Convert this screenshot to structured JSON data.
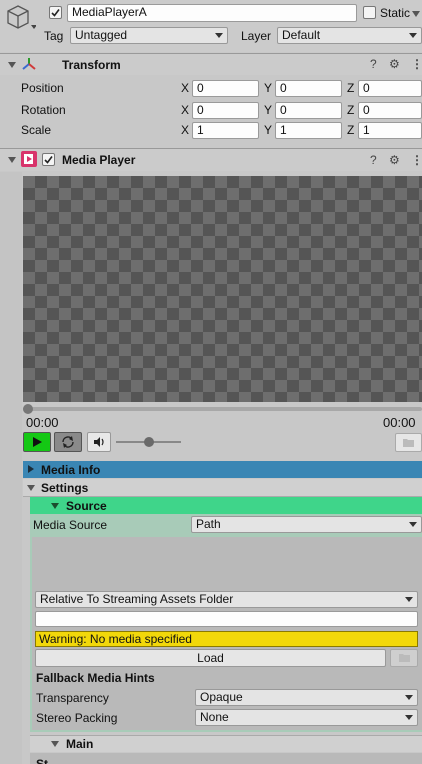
{
  "object": {
    "name": "MediaPlayerA",
    "static_label": "Static",
    "tag_label": "Tag",
    "tag_value": "Untagged",
    "layer_label": "Layer",
    "layer_value": "Default"
  },
  "transform": {
    "title": "Transform",
    "rows": [
      {
        "label": "Position",
        "x": "0",
        "y": "0",
        "z": "0"
      },
      {
        "label": "Rotation",
        "x": "0",
        "y": "0",
        "z": "0"
      },
      {
        "label": "Scale",
        "x": "1",
        "y": "1",
        "z": "1"
      }
    ],
    "axes": {
      "x": "X",
      "y": "Y",
      "z": "Z"
    }
  },
  "media_player": {
    "title": "Media Player",
    "time_start": "00:00",
    "time_end": "00:00",
    "volume": 0.5,
    "seek": 0.0
  },
  "sections": {
    "media_info": "Media Info",
    "settings": "Settings",
    "source": "Source",
    "main": "Main",
    "partial": "St..."
  },
  "source": {
    "media_source_label": "Media Source",
    "media_source_value": "Path",
    "relative_value": "Relative To Streaming Assets Folder",
    "path_value": "",
    "warning": "Warning: No media specified",
    "load_label": "Load",
    "fallback_title": "Fallback Media Hints",
    "transparency_label": "Transparency",
    "transparency_value": "Opaque",
    "stereo_label": "Stereo Packing",
    "stereo_value": "None"
  },
  "colors": {
    "media_info_bar": "#3a86b4",
    "source_bar": "#3fd58a",
    "source_panel": "#a8cbb8",
    "warning": "#f2d80a",
    "play_button": "#14c814"
  }
}
